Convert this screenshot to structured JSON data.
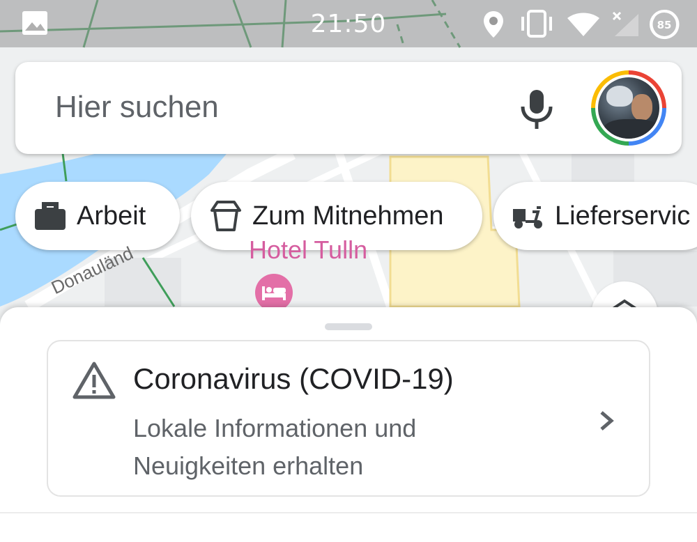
{
  "status_bar": {
    "time": "21:50",
    "battery_percent": "85",
    "icons": [
      "gallery-icon",
      "location-icon",
      "vibrate-icon",
      "wifi-icon",
      "no-signal-icon",
      "battery-icon"
    ]
  },
  "search": {
    "placeholder": "Hier suchen",
    "mic_icon": "mic-icon",
    "avatar_icon": "account-avatar"
  },
  "chips": [
    {
      "label": "Arbeit",
      "icon": "briefcase-icon"
    },
    {
      "label": "Zum Mitnehmen",
      "icon": "takeout-icon"
    },
    {
      "label": "Lieferservic",
      "icon": "delivery-icon"
    }
  ],
  "map": {
    "poi_label": "Hotel Tulln",
    "street_label": "Donauländ",
    "poi_icon": "hotel-icon",
    "colors": {
      "water": "#aadaff",
      "land": "#eef0f1",
      "road": "#ffffff",
      "transit": "#3f9e5a",
      "building": "#fdf3c8",
      "hotel": "#e36fa7"
    }
  },
  "covid_card": {
    "title": "Coronavirus (COVID-19)",
    "subtitle_line1": "Lokale Informationen und",
    "subtitle_line2": "Neuigkeiten erhalten",
    "icon": "warning-icon"
  }
}
